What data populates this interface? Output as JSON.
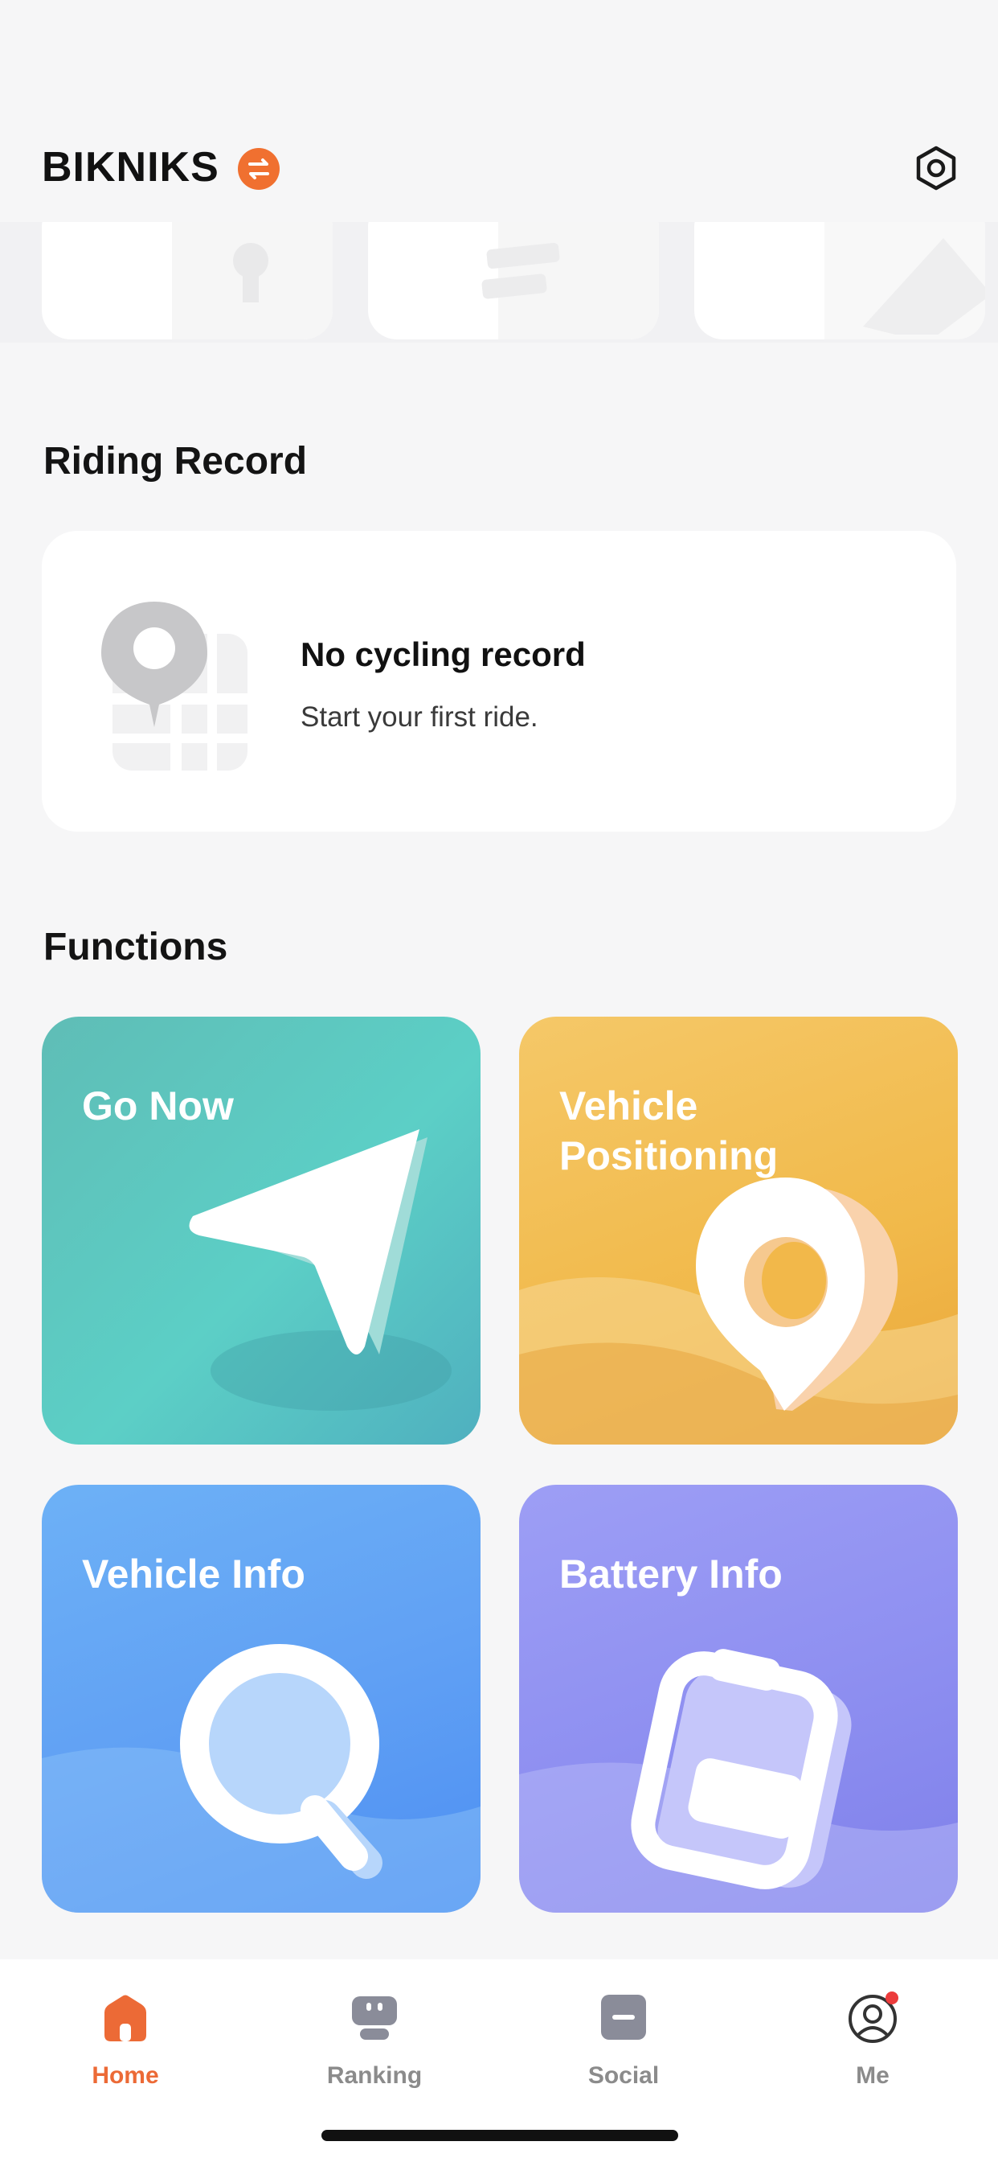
{
  "header": {
    "brand": "BIKNIKS",
    "switch_icon": "swap-arrows-icon",
    "settings_icon": "hexagon-settings-icon"
  },
  "quick_actions": [
    {
      "icon": "lock-icon"
    },
    {
      "icon": "list-icon"
    },
    {
      "icon": "edit-icon"
    }
  ],
  "riding_record": {
    "title": "Riding Record",
    "empty_title": "No cycling record",
    "empty_subtitle": "Start your first ride.",
    "icon": "map-pin-icon"
  },
  "functions": {
    "title": "Functions",
    "items": [
      {
        "label": "Go Now",
        "icon": "navigation-arrow-icon",
        "color": "#5cc9c2"
      },
      {
        "label": "Vehicle Positioning",
        "icon": "location-pin-icon",
        "color": "#f3be55"
      },
      {
        "label": "Vehicle Info",
        "icon": "magnifier-icon",
        "color": "#62a3f4"
      },
      {
        "label": "Battery Info",
        "icon": "battery-icon",
        "color": "#8f90f1"
      }
    ]
  },
  "tabbar": {
    "items": [
      {
        "label": "Home",
        "icon": "home-icon",
        "active": true
      },
      {
        "label": "Ranking",
        "icon": "ranking-icon",
        "active": false
      },
      {
        "label": "Social",
        "icon": "social-icon",
        "active": false
      },
      {
        "label": "Me",
        "icon": "profile-icon",
        "active": false,
        "badge": true
      }
    ]
  },
  "colors": {
    "accent": "#ec6a36",
    "background": "#f6f6f7"
  }
}
